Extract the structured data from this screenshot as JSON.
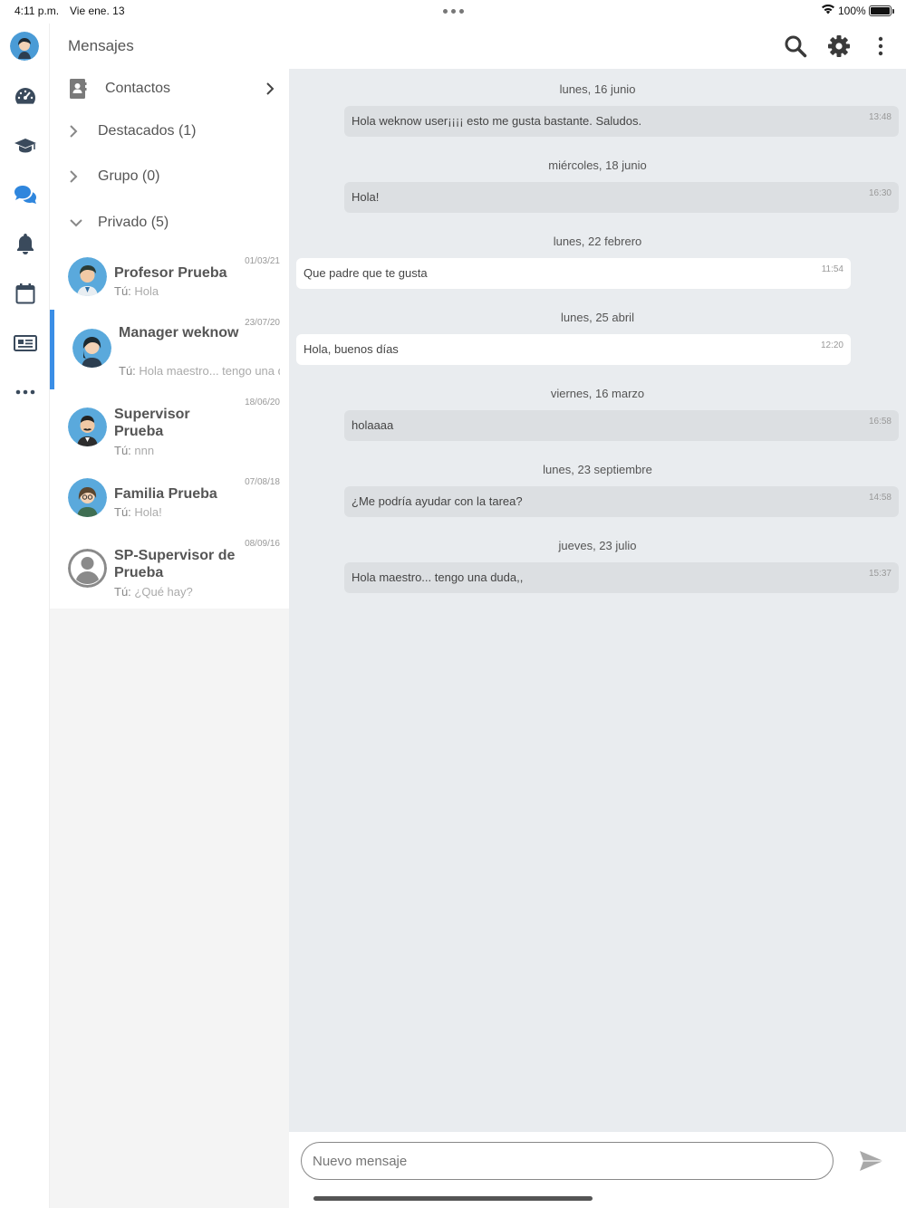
{
  "status_bar": {
    "time": "4:11 p.m.",
    "date": "Vie ene. 13",
    "battery": "100%"
  },
  "header": {
    "title": "Mensajes"
  },
  "sidebar": {
    "contacts_label": "Contactos",
    "groups": [
      {
        "label": "Destacados (1)",
        "expanded": false
      },
      {
        "label": "Grupo (0)",
        "expanded": false
      },
      {
        "label": "Privado (5)",
        "expanded": true
      }
    ],
    "conversations": [
      {
        "name": "Profesor Prueba",
        "date": "01/03/21",
        "prefix": "Tú:",
        "preview": "Hola"
      },
      {
        "name": "Manager weknow",
        "date": "23/07/20",
        "prefix": "Tú:",
        "preview": "Hola maestro... tengo una duda,,"
      },
      {
        "name": "Supervisor Prueba",
        "date": "18/06/20",
        "prefix": "Tú:",
        "preview": "nnn"
      },
      {
        "name": "Familia Prueba",
        "date": "07/08/18",
        "prefix": "Tú:",
        "preview": "Hola!"
      },
      {
        "name": "SP-Supervisor de Prueba",
        "date": "08/09/16",
        "prefix": "Tú:",
        "preview": "¿Qué hay?"
      }
    ]
  },
  "chat": {
    "messages": [
      {
        "day": "lunes, 16 junio",
        "text": "Hola weknow user¡¡¡¡ esto me gusta bastante. Saludos.",
        "time": "13:48",
        "direction": "sent"
      },
      {
        "day": "miércoles, 18 junio",
        "text": "Hola!",
        "time": "16:30",
        "direction": "sent"
      },
      {
        "day": "lunes, 22 febrero",
        "text": "Que padre que te gusta",
        "time": "11:54",
        "direction": "received"
      },
      {
        "day": "lunes, 25 abril",
        "text": "Hola, buenos días",
        "time": "12:20",
        "direction": "received"
      },
      {
        "day": "viernes, 16 marzo",
        "text": "holaaaa",
        "time": "16:58",
        "direction": "sent"
      },
      {
        "day": "lunes, 23 septiembre",
        "text": "¿Me podría ayudar con la tarea?",
        "time": "14:58",
        "direction": "sent"
      },
      {
        "day": "jueves, 23 julio",
        "text": "Hola maestro... tengo una duda,,",
        "time": "15:37",
        "direction": "sent"
      }
    ]
  },
  "composer": {
    "placeholder": "Nuevo mensaje"
  },
  "colors": {
    "accent": "#3a8ee6",
    "chat_bg": "#e9ecef",
    "sent_bubble": "#dcdfe2",
    "received_bubble": "#ffffff"
  }
}
